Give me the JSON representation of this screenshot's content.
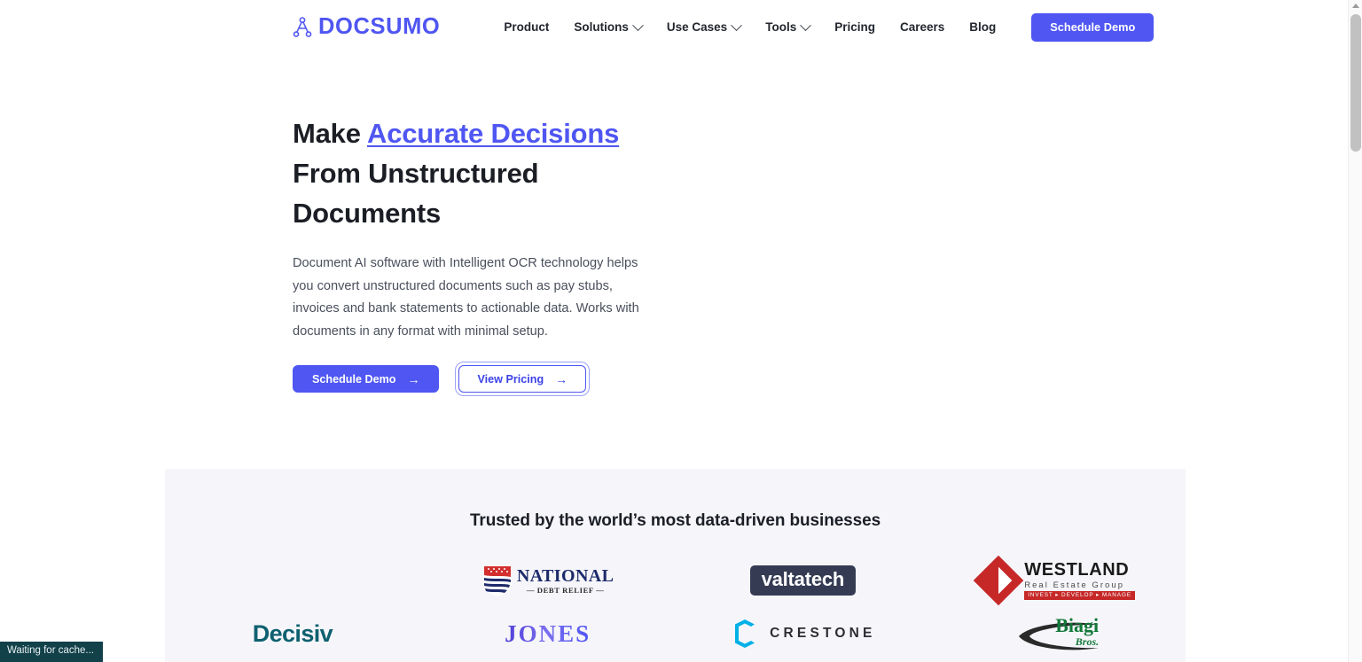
{
  "brand": {
    "name": "DOCSUMO",
    "logo_icon": "docsumo-node-graph-icon",
    "accent_color": "#4f56f2"
  },
  "nav": {
    "items": [
      {
        "label": "Product",
        "has_dropdown": false
      },
      {
        "label": "Solutions",
        "has_dropdown": true
      },
      {
        "label": "Use Cases",
        "has_dropdown": true
      },
      {
        "label": "Tools",
        "has_dropdown": true
      },
      {
        "label": "Pricing",
        "has_dropdown": false
      },
      {
        "label": "Careers",
        "has_dropdown": false
      },
      {
        "label": "Blog",
        "has_dropdown": false
      }
    ],
    "cta_label": "Schedule Demo"
  },
  "hero": {
    "title_part1": "Make ",
    "title_highlight": "Accurate Decisions",
    "title_part2": " From Unstructured Documents",
    "subtitle": "Document AI software with Intelligent OCR technology helps you convert unstructured documents such as pay stubs, invoices and bank statements to actionable data. Works with documents in any format with minimal setup.",
    "primary_button": "Schedule Demo",
    "secondary_button": "View Pricing",
    "arrow_glyph": "→"
  },
  "trusted": {
    "title": "Trusted by the world’s most data-driven businesses",
    "background_color": "#f6f6fa",
    "logos": [
      {
        "name": "National Debt Relief",
        "line1": "NATIONAL",
        "line2": "— DEBT RELIEF —",
        "color": "#1d2b6b"
      },
      {
        "name": "valtatech",
        "line1": "valtatech",
        "color": "#343b52"
      },
      {
        "name": "Westland Real Estate Group",
        "line1": "WESTLAND",
        "line2": "Real Estate Group",
        "line3": "INVEST ▸ DEVELOP ▸ MANAGE",
        "color": "#c62828"
      },
      {
        "name": "Decisiv",
        "line1": "Decisiv",
        "color": "#0e6070"
      },
      {
        "name": "Jones",
        "line1": "JONES",
        "color": "#4f3fd6"
      },
      {
        "name": "Crestone",
        "line1": "CRESTONE",
        "color": "#00b0e6"
      },
      {
        "name": "Biagi Bros",
        "line1": "Biagi",
        "line2": "Bros.",
        "color": "#12793a"
      }
    ]
  },
  "status": {
    "message": "Waiting for cache..."
  }
}
